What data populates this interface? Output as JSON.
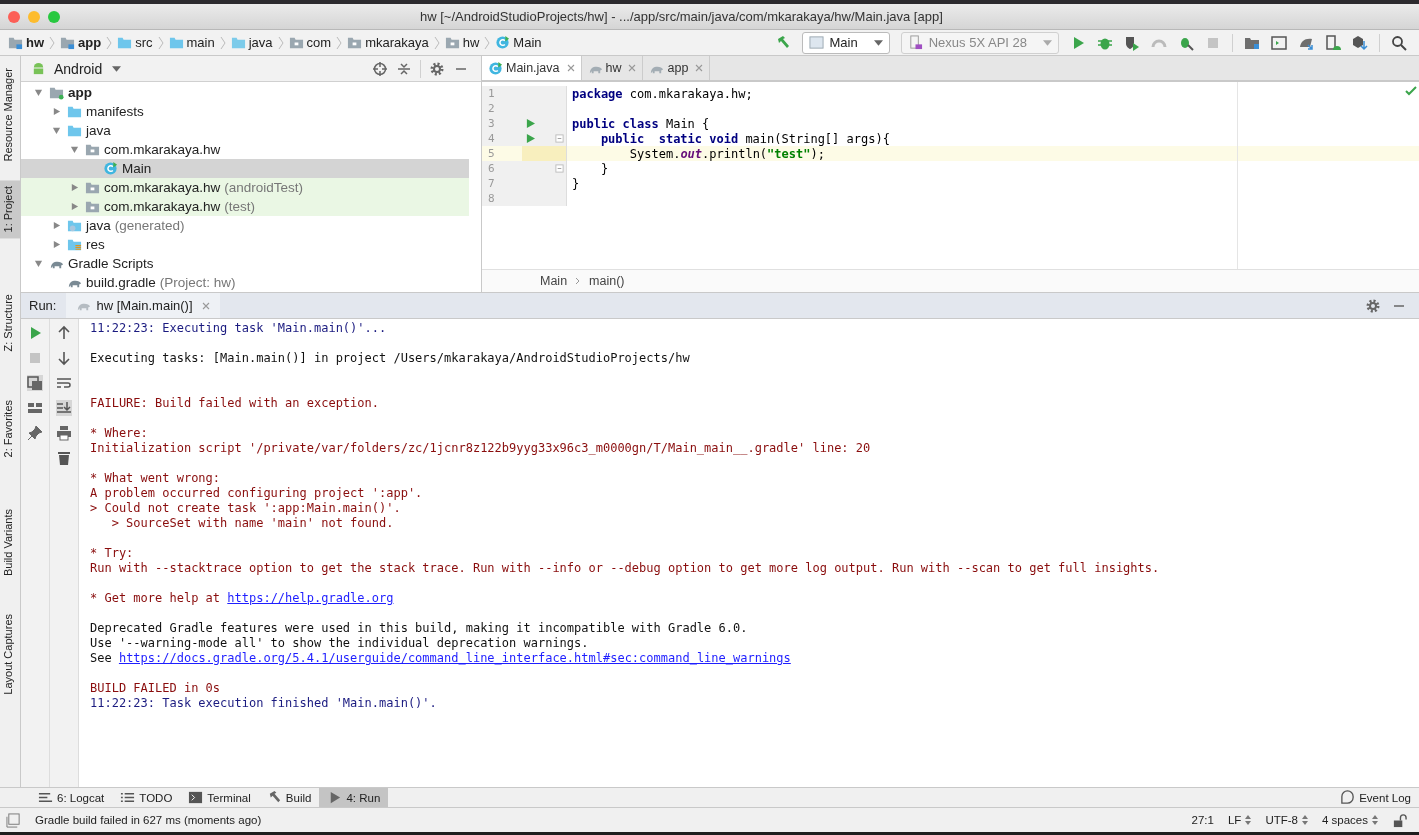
{
  "window": {
    "title": "hw [~/AndroidStudioProjects/hw] - .../app/src/main/java/com/mkarakaya/hw/Main.java [app]"
  },
  "nav_bar": {
    "crumbs": [
      {
        "label": "hw",
        "kind": "module",
        "bold": true
      },
      {
        "label": "app",
        "kind": "module",
        "bold": true
      },
      {
        "label": "src",
        "kind": "folder",
        "bold": false
      },
      {
        "label": "main",
        "kind": "folder",
        "bold": false
      },
      {
        "label": "java",
        "kind": "source",
        "bold": false
      },
      {
        "label": "com",
        "kind": "package",
        "bold": false
      },
      {
        "label": "mkarakaya",
        "kind": "package",
        "bold": false
      },
      {
        "label": "hw",
        "kind": "package",
        "bold": false
      },
      {
        "label": "Main",
        "kind": "class",
        "bold": false
      }
    ],
    "run_config": "Main",
    "device": "Nexus 5X API 28"
  },
  "side_strip": [
    {
      "label": "Resource Manager",
      "selected": false
    },
    {
      "label": "1: Project",
      "selected": true
    },
    {
      "label": "Z: Structure",
      "selected": false
    },
    {
      "label": "2: Favorites",
      "selected": false
    },
    {
      "label": "Build Variants",
      "selected": false
    },
    {
      "label": "Layout Captures",
      "selected": false
    }
  ],
  "project_panel": {
    "view": "Android",
    "tree": [
      {
        "label": "app",
        "kind": "module",
        "bold": true,
        "selected": false,
        "highlighted": false,
        "expanded": true,
        "children": [
          {
            "label": "manifests",
            "kind": "folder",
            "bold": false,
            "selected": false,
            "highlighted": false,
            "expanded": false
          },
          {
            "label": "java",
            "kind": "folder",
            "bold": false,
            "selected": false,
            "highlighted": false,
            "expanded": true,
            "children": [
              {
                "label": "com.mkarakaya.hw",
                "kind": "package",
                "bold": false,
                "selected": false,
                "highlighted": false,
                "expanded": true,
                "children": [
                  {
                    "label": "Main",
                    "kind": "class",
                    "bold": false,
                    "selected": true,
                    "highlighted": false
                  }
                ]
              },
              {
                "label": "com.mkarakaya.hw",
                "note": "(androidTest)",
                "kind": "package",
                "bold": false,
                "selected": false,
                "highlighted": true,
                "expanded": false
              },
              {
                "label": "com.mkarakaya.hw",
                "note": "(test)",
                "kind": "package",
                "bold": false,
                "selected": false,
                "highlighted": true,
                "expanded": false
              }
            ]
          },
          {
            "label": "java",
            "note": "(generated)",
            "kind": "generated",
            "bold": false,
            "selected": false,
            "highlighted": false,
            "expanded": false
          },
          {
            "label": "res",
            "kind": "res",
            "bold": false,
            "selected": false,
            "highlighted": false,
            "expanded": false
          }
        ]
      },
      {
        "label": "Gradle Scripts",
        "kind": "gradle",
        "bold": false,
        "selected": false,
        "highlighted": false,
        "expanded": true,
        "children": [
          {
            "label": "build.gradle",
            "note": "(Project: hw)",
            "kind": "gradle",
            "bold": false,
            "selected": false,
            "highlighted": false
          }
        ]
      }
    ]
  },
  "editor": {
    "tabs": [
      {
        "label": "Main.java",
        "kind": "class",
        "selected": true
      },
      {
        "label": "hw",
        "kind": "gradle",
        "selected": false
      },
      {
        "label": "app",
        "kind": "gradle",
        "selected": false
      }
    ],
    "lines": [
      {
        "number": "1",
        "run": false,
        "fold": false,
        "current": false,
        "tokens": [
          {
            "text": "package",
            "kind": "kw"
          },
          {
            "text": " com.mkarakaya.hw;",
            "kind": "plain"
          }
        ]
      },
      {
        "number": "2",
        "run": false,
        "fold": false,
        "current": false
      },
      {
        "number": "3",
        "run": true,
        "fold": false,
        "current": false,
        "tokens": [
          {
            "text": "public class",
            "kind": "kw"
          },
          {
            "text": " Main {",
            "kind": "plain"
          }
        ]
      },
      {
        "number": "4",
        "run": true,
        "fold": true,
        "current": false,
        "tokens": [
          {
            "text": "    public  static void",
            "kind": "kw"
          },
          {
            "text": " main(String[] args){",
            "kind": "plain"
          }
        ]
      },
      {
        "number": "5",
        "run": false,
        "fold": false,
        "current": true,
        "tokens": [
          {
            "text": "        System.",
            "kind": "plain"
          },
          {
            "text": "out",
            "kind": "field"
          },
          {
            "text": ".println(",
            "kind": "plain"
          },
          {
            "text": "\"test\"",
            "kind": "str"
          },
          {
            "text": ");",
            "kind": "plain"
          }
        ]
      },
      {
        "number": "6",
        "run": false,
        "fold": true,
        "current": false,
        "tokens": [
          {
            "text": "    }",
            "kind": "plain"
          }
        ]
      },
      {
        "number": "7",
        "run": false,
        "fold": false,
        "current": false,
        "tokens": [
          {
            "text": "}",
            "kind": "plain"
          }
        ]
      },
      {
        "number": "8",
        "run": false,
        "fold": false,
        "current": false
      }
    ],
    "breadcrumb": [
      "Main",
      "main()"
    ]
  },
  "run_panel": {
    "label": "Run:",
    "tab": "hw [Main.main()]",
    "blocks": [
      [
        [
          {
            "text": "11:22:23: Executing task 'Main.main()'...",
            "kind": "info"
          }
        ]
      ],
      [
        [
          {
            "text": "Executing tasks: [Main.main()] in project /Users/mkarakaya/AndroidStudioProjects/hw",
            "kind": "plain"
          }
        ]
      ],
      [
        [
          {
            "text": "FAILURE: Build failed with an exception.",
            "kind": "error"
          }
        ]
      ],
      [
        [
          {
            "text": "* Where:",
            "kind": "error"
          }
        ],
        [
          {
            "text": "Initialization script '/private/var/folders/zc/1jcnr8z122b9yyg33x96c3_m0000gn/T/Main_main__.gradle' line: 20",
            "kind": "error"
          }
        ]
      ],
      [
        [
          {
            "text": "* What went wrong:",
            "kind": "error"
          }
        ],
        [
          {
            "text": "A problem occurred configuring project ':app'.",
            "kind": "error"
          }
        ],
        [
          {
            "text": "> Could not create task ':app:Main.main()'.",
            "kind": "error"
          }
        ],
        [
          {
            "text": "   > SourceSet with name 'main' not found.",
            "kind": "error"
          }
        ]
      ],
      [
        [
          {
            "text": "* Try:",
            "kind": "error"
          }
        ],
        [
          {
            "text": "Run with --stacktrace option to get the stack trace. Run with --info or --debug option to get more log output. Run with --scan to get full insights.",
            "kind": "error"
          }
        ]
      ],
      [
        [
          {
            "text": "* Get more help at ",
            "kind": "error"
          },
          {
            "text": "https://help.gradle.org",
            "kind": "link"
          }
        ]
      ],
      [
        [
          {
            "text": "Deprecated Gradle features were used in this build, making it incompatible with Gradle 6.0.",
            "kind": "plain"
          }
        ],
        [
          {
            "text": "Use '--warning-mode all' to show the individual deprecation warnings.",
            "kind": "plain"
          }
        ],
        [
          {
            "text": "See ",
            "kind": "plain"
          },
          {
            "text": "https://docs.gradle.org/5.4.1/userguide/command_line_interface.html#sec:command_line_warnings",
            "kind": "link"
          }
        ]
      ],
      [
        [
          {
            "text": "BUILD FAILED in 0s",
            "kind": "error"
          }
        ],
        [
          {
            "text": "11:22:23: Task execution finished 'Main.main()'.",
            "kind": "info"
          }
        ]
      ]
    ]
  },
  "bottom_tabs": [
    {
      "label": "6: Logcat",
      "kind": "logcat",
      "selected": false
    },
    {
      "label": "TODO",
      "kind": "todo",
      "selected": false
    },
    {
      "label": "Terminal",
      "kind": "terminal",
      "selected": false
    },
    {
      "label": "Build",
      "kind": "hammer",
      "selected": false
    },
    {
      "label": "4: Run",
      "kind": "run",
      "selected": true
    }
  ],
  "event_log": "Event Log",
  "status_bar": {
    "message": "Gradle build failed in 627 ms (moments ago)",
    "position": "27:1",
    "line_sep": "LF",
    "encoding": "UTF-8",
    "indent": "4 spaces"
  }
}
